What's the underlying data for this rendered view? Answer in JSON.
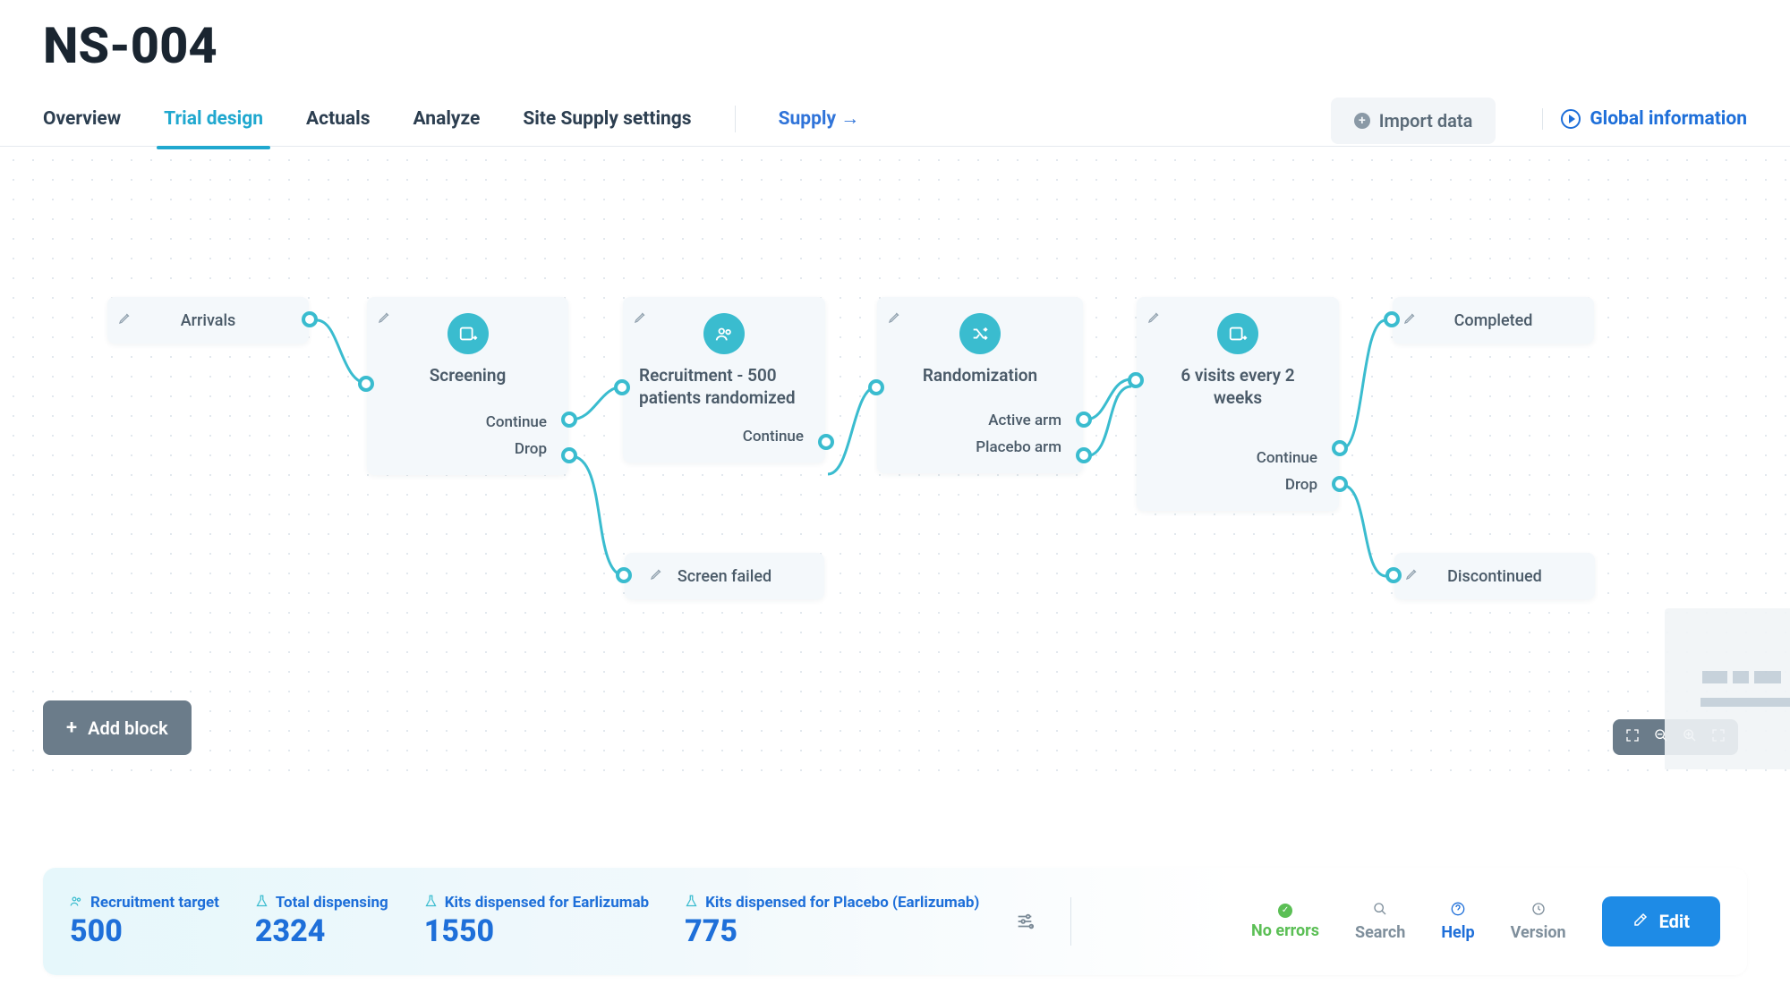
{
  "page": {
    "title": "NS-004"
  },
  "tabs": {
    "overview": "Overview",
    "trial_design": "Trial design",
    "actuals": "Actuals",
    "analyze": "Analyze",
    "site_supply": "Site Supply settings",
    "supply": "Supply →",
    "import": "Import data",
    "global_info": "Global information"
  },
  "canvas": {
    "add_block": "Add block"
  },
  "nodes": {
    "arrivals": {
      "label": "Arrivals"
    },
    "screening": {
      "title": "Screening",
      "out1": "Continue",
      "out2": "Drop"
    },
    "recruitment": {
      "title": "Recruitment - 500 patients randomized",
      "out1": "Continue"
    },
    "randomization": {
      "title": "Randomization",
      "out1": "Active arm",
      "out2": "Placebo arm"
    },
    "visits": {
      "title": "6 visits every 2 weeks",
      "out1": "Continue",
      "out2": "Drop"
    },
    "completed": {
      "label": "Completed"
    },
    "screen_failed": {
      "label": "Screen failed"
    },
    "discontinued": {
      "label": "Discontinued"
    }
  },
  "footer": {
    "stats": {
      "recruitment_target": {
        "label": "Recruitment target",
        "value": "500"
      },
      "total_dispensing": {
        "label": "Total dispensing",
        "value": "2324"
      },
      "kits_earlizumab": {
        "label": "Kits dispensed for Earlizumab",
        "value": "1550"
      },
      "kits_placebo": {
        "label": "Kits dispensed for Placebo (Earlizumab)",
        "value": "775"
      }
    },
    "status": "No errors",
    "search": "Search",
    "help": "Help",
    "version": "Version",
    "edit": "Edit"
  }
}
